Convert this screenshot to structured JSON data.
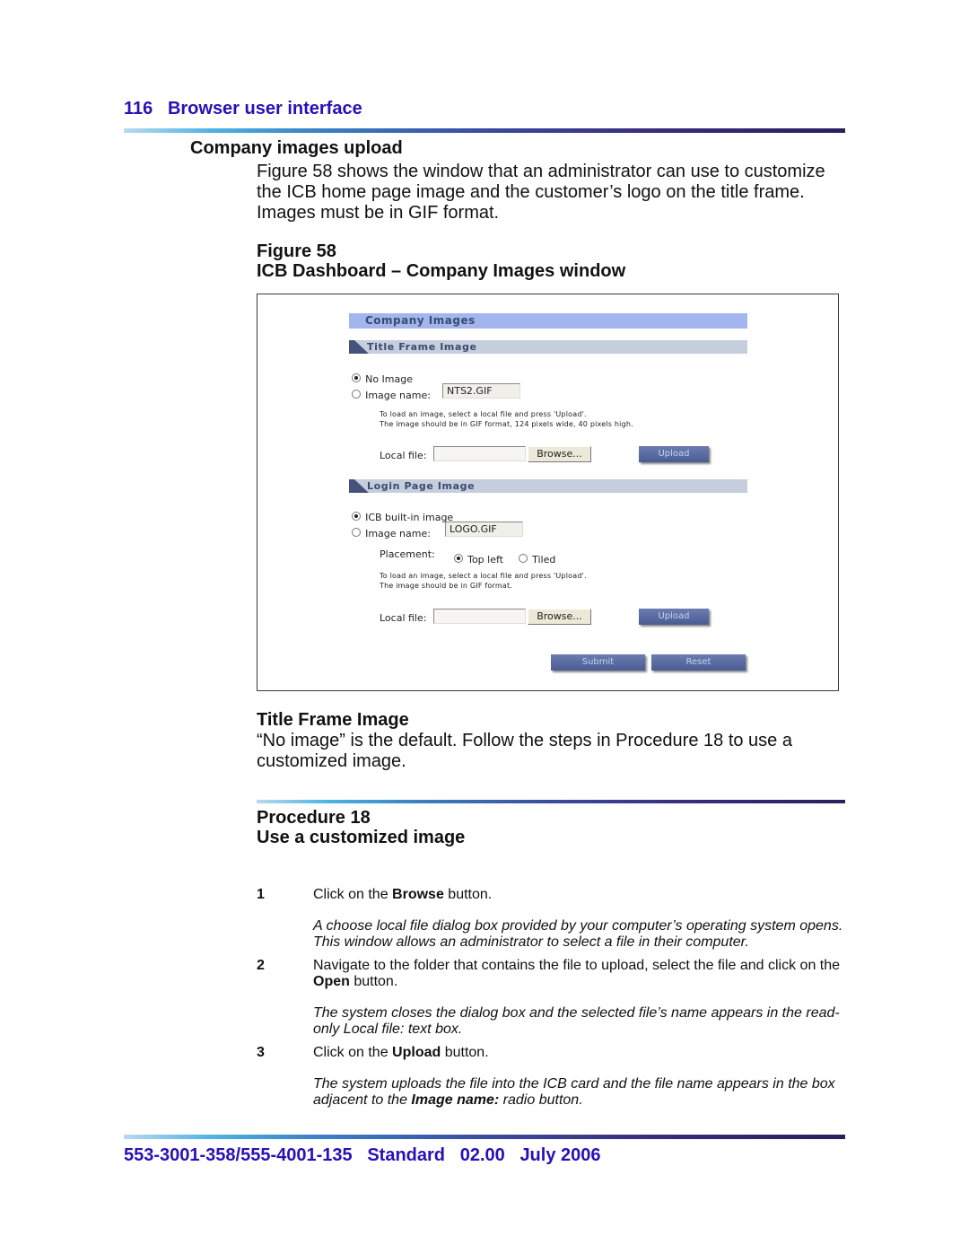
{
  "header": {
    "page_number": "116",
    "chapter_title": "Browser user interface"
  },
  "section": {
    "heading": "Company images upload",
    "intro": "Figure 58 shows the window that an administrator can use to customize the ICB home page image and the customer’s logo on the title frame. Images must be in GIF format."
  },
  "figure": {
    "number": "Figure 58",
    "title": "ICB Dashboard – Company Images window",
    "window": {
      "title": "Company Images",
      "title_frame": {
        "heading": "Title Frame Image",
        "options": [
          {
            "label": "No Image",
            "selected": true
          },
          {
            "label": "Image name:",
            "selected": false
          }
        ],
        "image_name_value": "NTS2.GIF",
        "instructions": [
          "To load an image, select a local file and press 'Upload'.",
          "The image should be in GIF format, 124 pixels wide, 40 pixels high."
        ],
        "local_file_label": "Local file:",
        "local_file_value": "",
        "browse_label": "Browse...",
        "upload_label": "Upload"
      },
      "login_page": {
        "heading": "Login Page Image",
        "options": [
          {
            "label": "ICB built-in image",
            "selected": true
          },
          {
            "label": "Image name:",
            "selected": false
          }
        ],
        "image_name_value": "LOGO.GIF",
        "placement_label": "Placement:",
        "placement_options": [
          {
            "label": "Top left",
            "selected": true
          },
          {
            "label": "Tiled",
            "selected": false
          }
        ],
        "instructions": [
          "To load an image, select a local file and press 'Upload'.",
          "The image should be in GIF format."
        ],
        "local_file_label": "Local file:",
        "local_file_value": "",
        "browse_label": "Browse...",
        "upload_label": "Upload"
      },
      "submit_label": "Submit",
      "reset_label": "Reset"
    }
  },
  "title_frame_section": {
    "heading": "Title Frame Image",
    "text": "“No image” is the default. Follow the steps in Procedure 18 to use a customized image."
  },
  "procedure": {
    "number": "Procedure 18",
    "title": "Use a customized image",
    "steps": [
      {
        "num": "1",
        "text_before": "Click on the ",
        "bold": "Browse",
        "text_after": " button.",
        "note": "A choose local file dialog box provided by your computer’s operating system opens. This window allows an administrator to select a file in their computer."
      },
      {
        "num": "2",
        "text_before": "Navigate to the folder that contains the file to upload, select the file and click on the ",
        "bold": "Open",
        "text_after": " button.",
        "note": "The system closes the dialog box and the selected file’s name appears in the read-only Local file: text box."
      },
      {
        "num": "3",
        "text_before": "Click on the ",
        "bold": "Upload",
        "text_after": " button.",
        "note_before": "The system uploads the file into the ICB card and the file name appears in the box adjacent to the ",
        "note_bold": "Image name:",
        "note_after": " radio button."
      }
    ]
  },
  "footer": {
    "doc_number": "553-3001-358/555-4001-135",
    "status": "Standard",
    "version": "02.00",
    "date": "July 2006"
  },
  "colors": {
    "heading_blue": "#2a0fb8",
    "window_title_bar": "#a3b4ee",
    "section_bar": "#c6cede",
    "button_blue": "#4f6198"
  }
}
